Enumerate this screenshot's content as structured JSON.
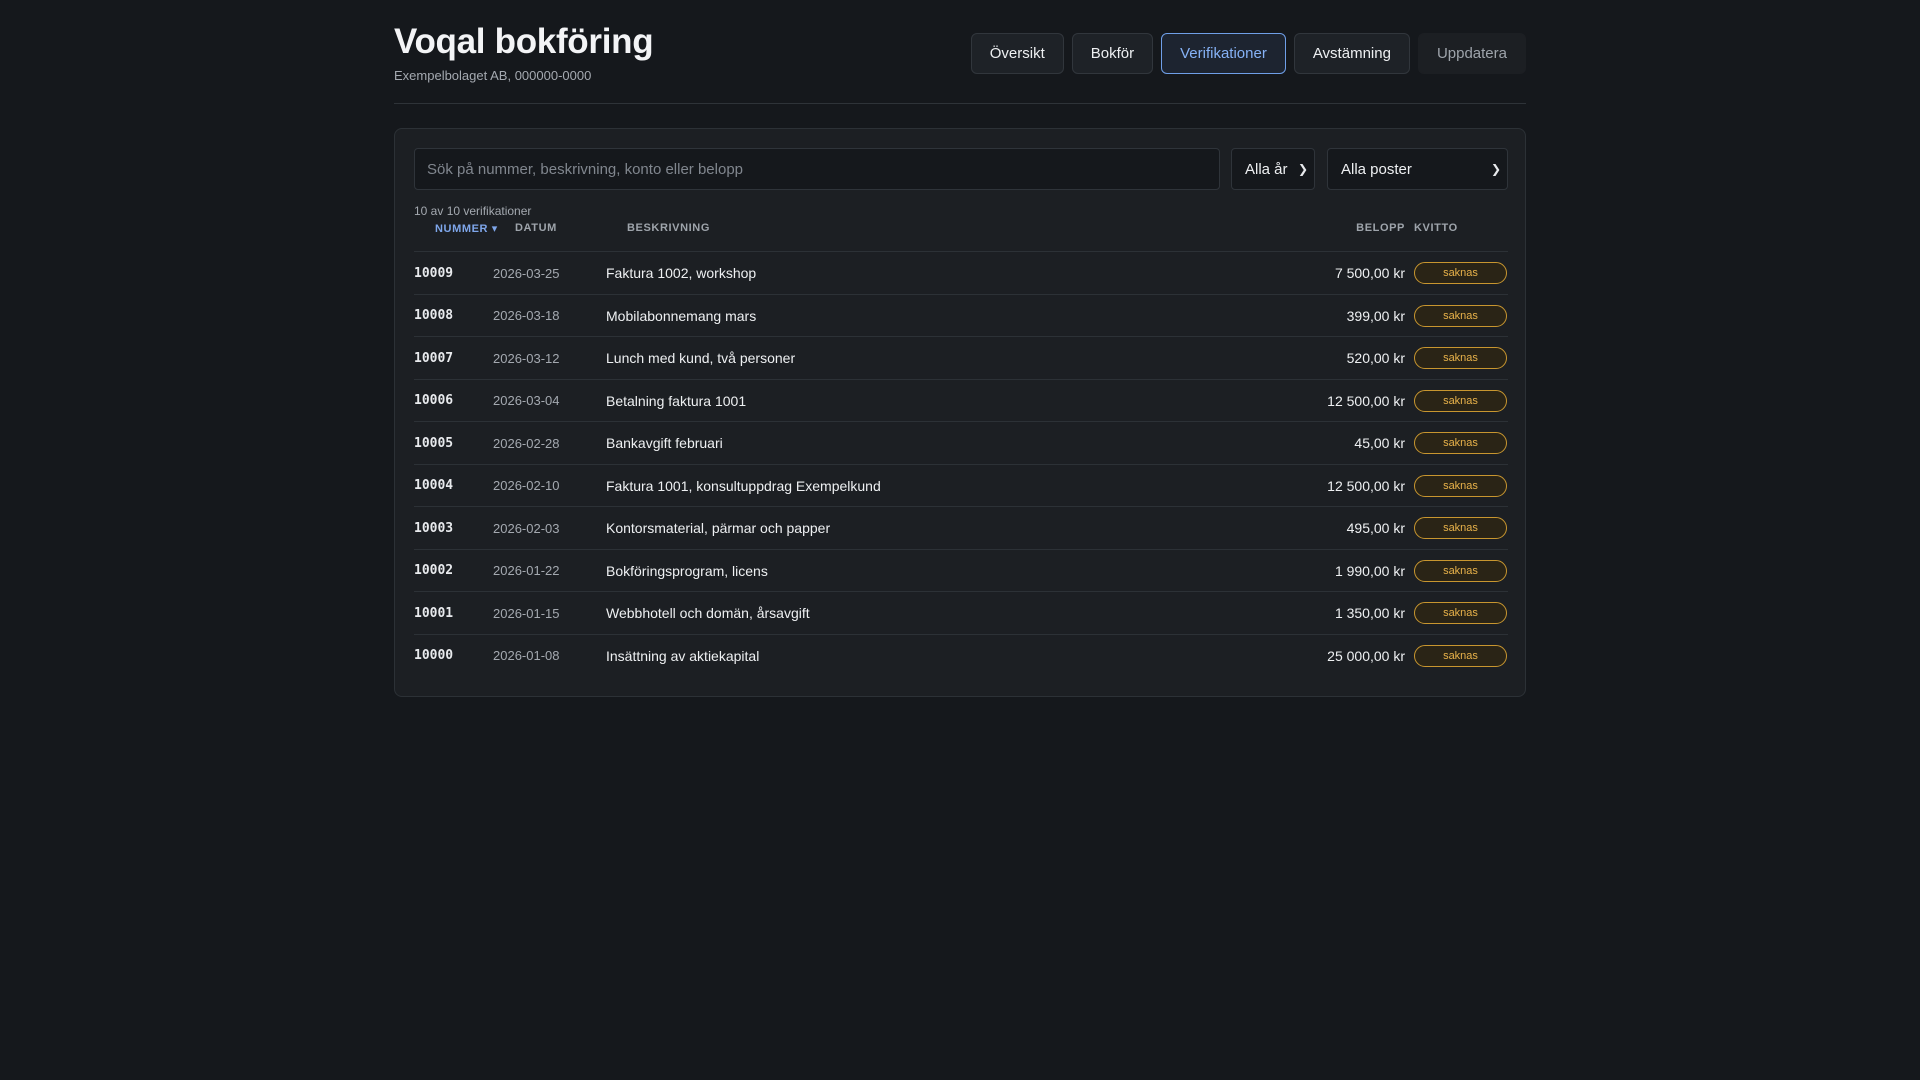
{
  "header": {
    "title": "Voqal bokföring",
    "subtitle": "Exempelbolaget AB, 000000-0000"
  },
  "nav": [
    {
      "label": "Översikt",
      "state": "default"
    },
    {
      "label": "Bokför",
      "state": "default"
    },
    {
      "label": "Verifikationer",
      "state": "active"
    },
    {
      "label": "Avstämning",
      "state": "default"
    },
    {
      "label": "Uppdatera",
      "state": "muted"
    }
  ],
  "filters": {
    "search_placeholder": "Sök på nummer, beskrivning, konto eller belopp",
    "year_selected": "Alla år",
    "posts_selected": "Alla poster"
  },
  "count_text": "10 av 10 verifikationer",
  "columns": {
    "number": "NUMMER",
    "sort_indicator": "▾",
    "date": "DATUM",
    "description": "BESKRIVNING",
    "amount": "BELOPP",
    "receipt": "KVITTO"
  },
  "rows": [
    {
      "number": "10009",
      "date": "2026-03-25",
      "description": "Faktura 1002, workshop",
      "amount": "7 500,00 kr",
      "receipt": "saknas"
    },
    {
      "number": "10008",
      "date": "2026-03-18",
      "description": "Mobilabonnemang mars",
      "amount": "399,00 kr",
      "receipt": "saknas"
    },
    {
      "number": "10007",
      "date": "2026-03-12",
      "description": "Lunch med kund, två personer",
      "amount": "520,00 kr",
      "receipt": "saknas"
    },
    {
      "number": "10006",
      "date": "2026-03-04",
      "description": "Betalning faktura 1001",
      "amount": "12 500,00 kr",
      "receipt": "saknas"
    },
    {
      "number": "10005",
      "date": "2026-02-28",
      "description": "Bankavgift februari",
      "amount": "45,00 kr",
      "receipt": "saknas"
    },
    {
      "number": "10004",
      "date": "2026-02-10",
      "description": "Faktura 1001, konsultuppdrag Exempelkund",
      "amount": "12 500,00 kr",
      "receipt": "saknas"
    },
    {
      "number": "10003",
      "date": "2026-02-03",
      "description": "Kontorsmaterial, pärmar och papper",
      "amount": "495,00 kr",
      "receipt": "saknas"
    },
    {
      "number": "10002",
      "date": "2026-01-22",
      "description": "Bokföringsprogram, licens",
      "amount": "1 990,00 kr",
      "receipt": "saknas"
    },
    {
      "number": "10001",
      "date": "2026-01-15",
      "description": "Webbhotell och domän, årsavgift",
      "amount": "1 350,00 kr",
      "receipt": "saknas"
    },
    {
      "number": "10000",
      "date": "2026-01-08",
      "description": "Insättning av aktiekapital",
      "amount": "25 000,00 kr",
      "receipt": "saknas"
    }
  ],
  "colors": {
    "background": "#15181c",
    "panel": "#1c1f23",
    "accent": "#7ea6ea",
    "warning": "#e8b24a"
  }
}
